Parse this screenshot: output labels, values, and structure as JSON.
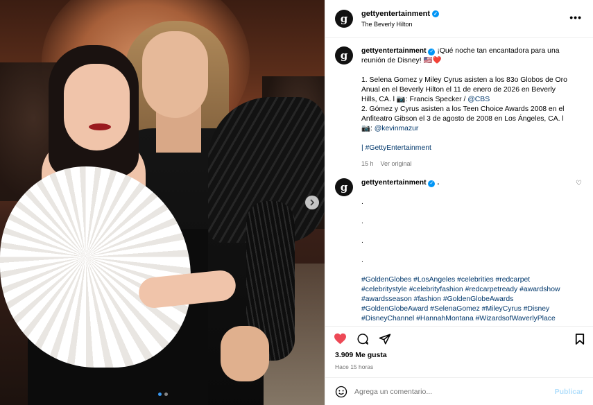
{
  "post": {
    "username": "gettyentertainment",
    "location": "The Beverly Hilton",
    "more_icon": "more-horizontal-icon"
  },
  "caption": {
    "username": "gettyentertainment",
    "lines": [
      "¡Qué noche tan encantadora para una",
      "reunión de Disney! ",
      "",
      "1. Selena Gomez y Miley Cyrus asisten a los 83o Globos de Oro",
      "Anual en el Beverly Hilton el 11 de enero de 2026 en Beverly",
      "Hills, CA. l 📷: Francis Specker / ",
      "2. Gómez y Cyrus asisten a los Teen Choice Awards 2008 en el",
      "Anfiteatro Gibson el 3 de agosto de 2008 en Los Ángeles, CA. l",
      "📷: "
    ],
    "emoji_suffix": "🇺🇸❤️",
    "mention_cbs": "@CBS",
    "mention_kevin": "@kevinmazur",
    "hashtag_getty": "| #GettyEntertainment",
    "time": "15 h",
    "see_original": "Ver original"
  },
  "comment2": {
    "username": "gettyentertainment",
    "text": ".",
    "dots": [
      ".",
      ".",
      ".",
      "."
    ],
    "hashtags": [
      "#GoldenGlobes #LosAngeles #celebrities #redcarpet",
      "#celebritystyle #celebrityfashion #redcarpetready #awardshow",
      "#awardsseason #fashion #GoldenGlobeAwards",
      "#GoldenGlobeAward #SelenaGomez #MileyCyrus #Disney",
      "#DisneyChannel #HannahMontana #WizardsofWaverlyPlace"
    ]
  },
  "engagement": {
    "likes": "3.909 Me gusta",
    "posted": "Hace 15 horas"
  },
  "composer": {
    "placeholder": "Agrega un comentario...",
    "publish": "Publicar"
  },
  "carousel": {
    "current": 1,
    "total": 2
  },
  "colors": {
    "accent": "#0095f6",
    "liked": "#ed4956",
    "link": "#00376b",
    "publish": "#b2dffc"
  }
}
